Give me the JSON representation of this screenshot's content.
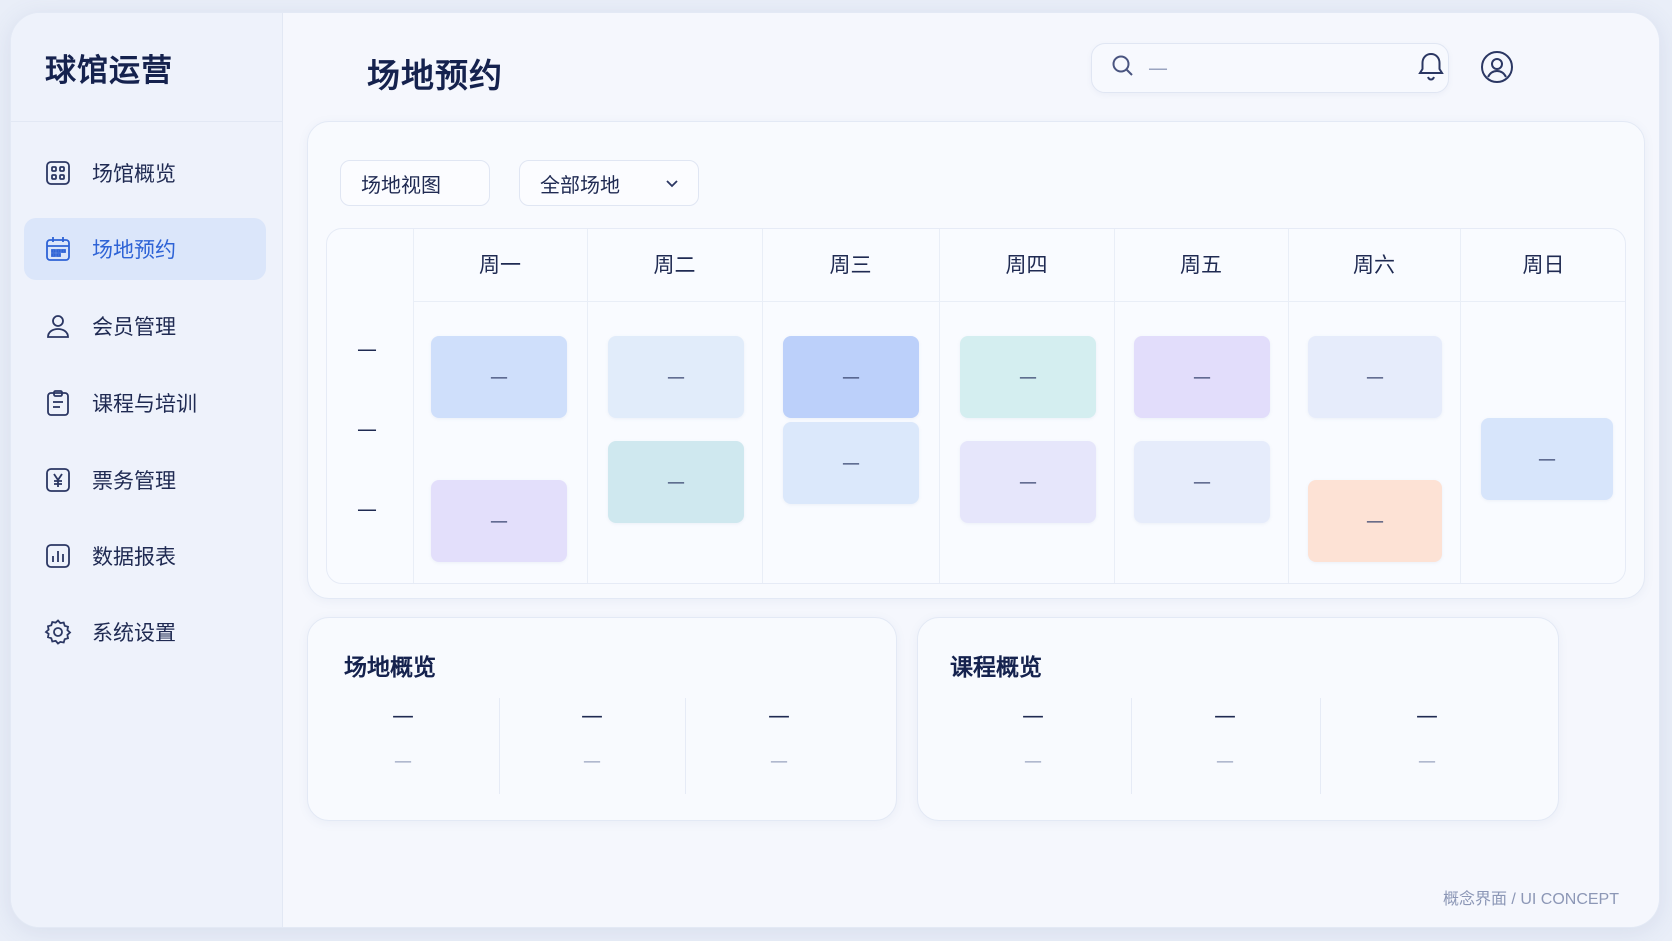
{
  "brand": "球馆运营",
  "sidebar": {
    "items": [
      {
        "label": "场馆概览",
        "icon": "dashboard-icon",
        "active": false
      },
      {
        "label": "场地预约",
        "icon": "calendar-icon",
        "active": true
      },
      {
        "label": "会员管理",
        "icon": "user-icon",
        "active": false
      },
      {
        "label": "课程与培训",
        "icon": "clipboard-icon",
        "active": false
      },
      {
        "label": "票务管理",
        "icon": "ticket-yen-icon",
        "active": false
      },
      {
        "label": "数据报表",
        "icon": "bar-chart-icon",
        "active": false
      },
      {
        "label": "系统设置",
        "icon": "gear-icon",
        "active": false
      }
    ]
  },
  "header": {
    "title": "场地预约",
    "search_placeholder": "—",
    "icons": [
      "bell-icon",
      "account-icon"
    ]
  },
  "schedule": {
    "view_label": "场地视图",
    "filter_label": "全部场地",
    "days": [
      "周一",
      "周二",
      "周三",
      "周四",
      "周五",
      "周六",
      "周日"
    ],
    "time_labels": [
      "—",
      "—",
      "—"
    ],
    "bookings": [
      {
        "day": "周一",
        "label": "—",
        "color": "#cfdffb"
      },
      {
        "day": "周一",
        "label": "—",
        "color": "#e3dffb"
      },
      {
        "day": "周二",
        "label": "—",
        "color": "#e1ecfa"
      },
      {
        "day": "周二",
        "label": "—",
        "color": "#cfe8ef"
      },
      {
        "day": "周三",
        "label": "—",
        "color": "#bcd0fa"
      },
      {
        "day": "周三",
        "label": "—",
        "color": "#dbe8fb"
      },
      {
        "day": "周四",
        "label": "—",
        "color": "#d4eef0"
      },
      {
        "day": "周四",
        "label": "—",
        "color": "#e6e6fb"
      },
      {
        "day": "周五",
        "label": "—",
        "color": "#e2ddfb"
      },
      {
        "day": "周五",
        "label": "—",
        "color": "#e6ecfb"
      },
      {
        "day": "周六",
        "label": "—",
        "color": "#e6ecfb"
      },
      {
        "day": "周六",
        "label": "—",
        "color": "#fde2d5"
      },
      {
        "day": "周日",
        "label": "—",
        "color": "#d7e5fb"
      }
    ]
  },
  "venue_overview": {
    "title": "场地概览",
    "stats": [
      {
        "value": "—",
        "label": "—"
      },
      {
        "value": "—",
        "label": "—"
      },
      {
        "value": "—",
        "label": "—"
      }
    ]
  },
  "course_overview": {
    "title": "课程概览",
    "stats": [
      {
        "value": "—",
        "label": "—"
      },
      {
        "value": "—",
        "label": "—"
      },
      {
        "value": "—",
        "label": "—"
      }
    ]
  },
  "footer": "概念界面 / UI CONCEPT"
}
